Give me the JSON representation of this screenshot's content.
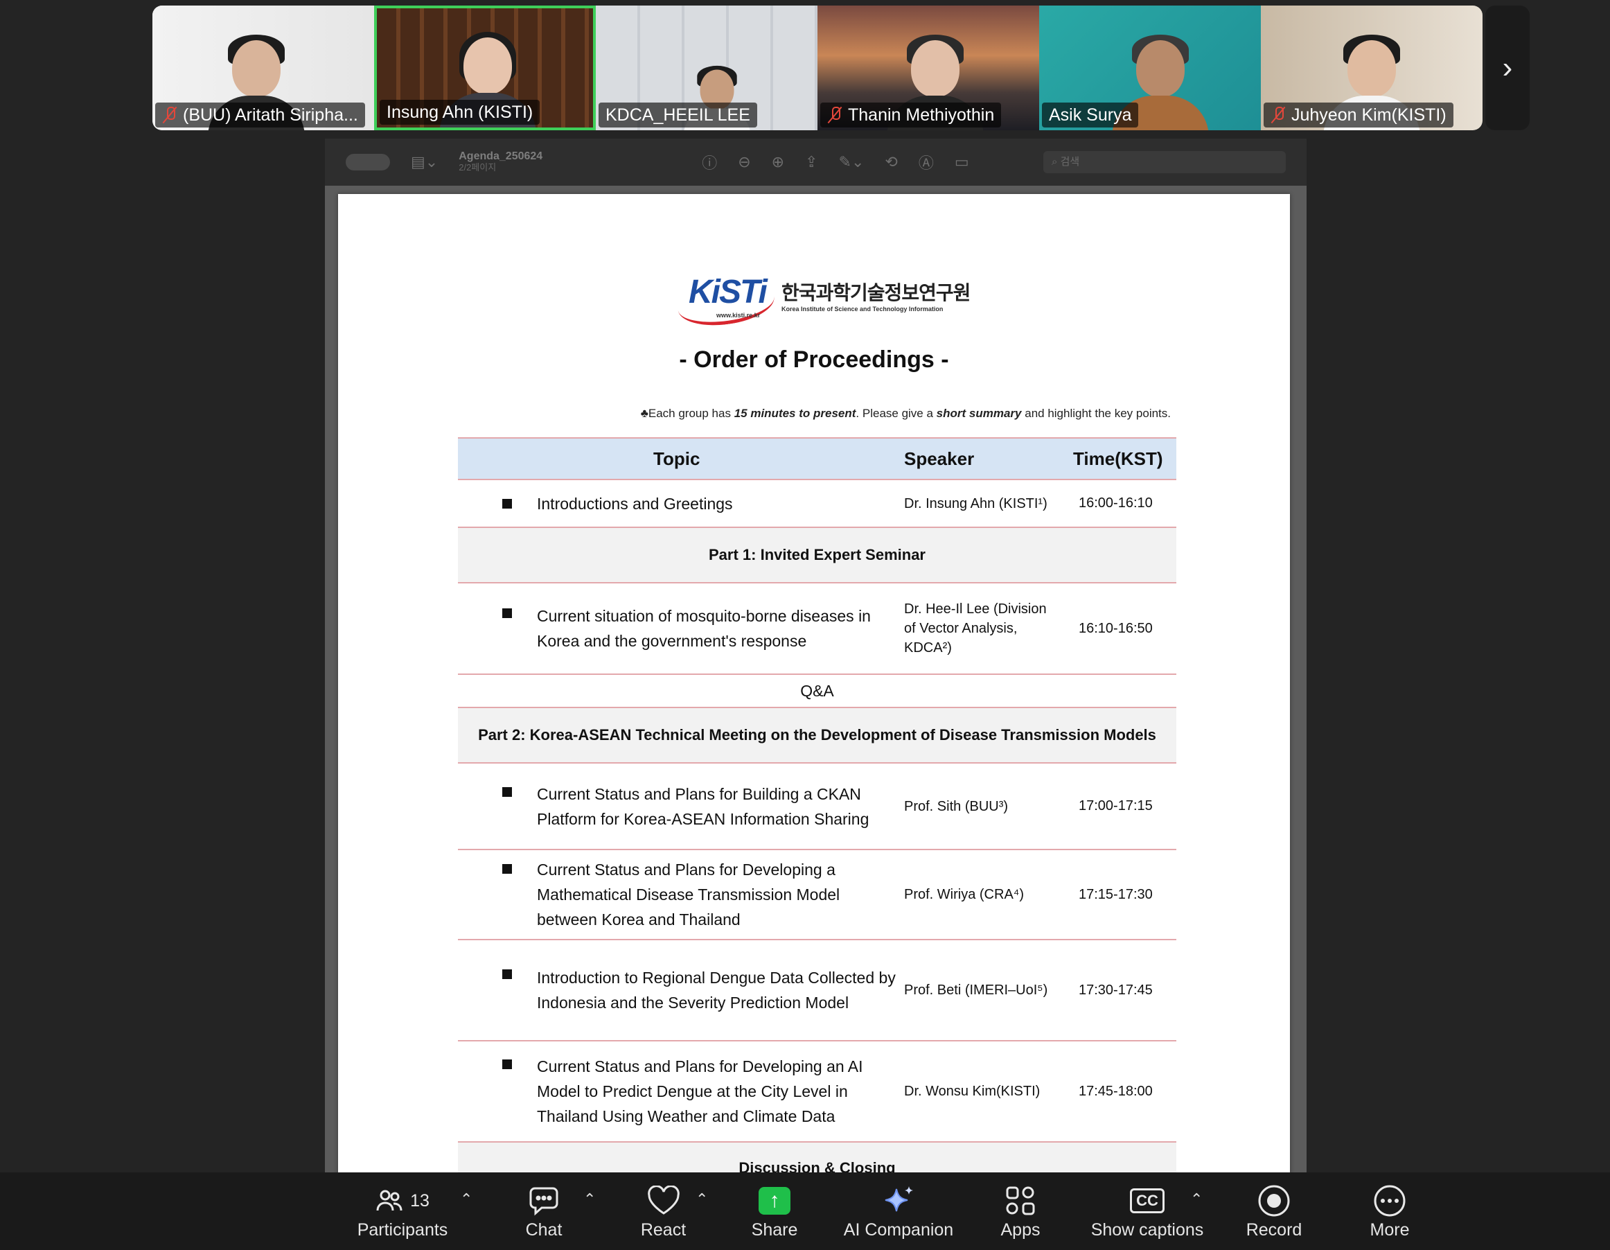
{
  "participants": [
    {
      "name": "(BUU) Aritath Siripha...",
      "muted": true,
      "active": false
    },
    {
      "name": "Insung Ahn (KISTI)",
      "muted": false,
      "active": true
    },
    {
      "name": "KDCA_HEEIL LEE",
      "muted": false,
      "active": false
    },
    {
      "name": "Thanin Methiyothin",
      "muted": true,
      "active": false
    },
    {
      "name": "Asik Surya",
      "muted": false,
      "active": false
    },
    {
      "name": "Juhyeon Kim(KISTI)",
      "muted": true,
      "active": false
    }
  ],
  "viewer": {
    "file_name": "Agenda_250624",
    "page_info": "2/2페이지",
    "search_placeholder": "검색"
  },
  "document": {
    "logo_korean": "한국과학기술정보연구원",
    "logo_english": "Korea Institute of Science and Technology Information",
    "logo_url": "www.kisti.re.kr",
    "logo_mark": "KiSTi",
    "title": "- Order of Proceedings -",
    "note_prefix": "♣Each group has",
    "note_em1": "15 minutes to present",
    "note_mid": ". Please give a",
    "note_em2": "short summary",
    "note_suffix": "and highlight the key points.",
    "headers": {
      "topic": "Topic",
      "speaker": "Speaker",
      "time": "Time(KST)"
    },
    "items": {
      "intro": {
        "topic": "Introductions and Greetings",
        "speaker": "Dr. Insung Ahn (KISTI¹)",
        "time": "16:00-16:10"
      },
      "part1": "Part 1: Invited Expert Seminar",
      "seminar": {
        "topic": "Current situation of mosquito-borne diseases in Korea and the government's response",
        "speaker": "Dr. Hee-Il Lee (Division of Vector Analysis, KDCA²)",
        "time": "16:10-16:50"
      },
      "qa": "Q&A",
      "part2": "Part 2: Korea-ASEAN Technical Meeting on the Development of Disease Transmission Models",
      "t1": {
        "topic": "Current Status and Plans for Building a CKAN Platform for Korea-ASEAN Information Sharing",
        "speaker": "Prof. Sith (BUU³)",
        "time": "17:00-17:15"
      },
      "t2": {
        "topic": "Current Status and Plans for Developing a Mathematical Disease Transmission Model between Korea and Thailand",
        "speaker": "Prof. Wiriya (CRA⁴)",
        "time": "17:15-17:30"
      },
      "t3": {
        "topic": "Introduction to Regional Dengue Data Collected by Indonesia and the Severity Prediction Model",
        "speaker": "Prof. Beti (IMERI–UoI⁵)",
        "time": "17:30-17:45"
      },
      "t4": {
        "topic": "Current Status and Plans for Developing an AI Model to Predict Dengue at the City Level in Thailand Using Weather and Climate Data",
        "speaker": "Dr. Wonsu Kim(KISTI)",
        "time": "17:45-18:00"
      },
      "closing": "Discussion & Closing"
    }
  },
  "controls": {
    "participants_label": "Participants",
    "participants_count": "13",
    "chat_label": "Chat",
    "react_label": "React",
    "share_label": "Share",
    "ai_label": "AI Companion",
    "apps_label": "Apps",
    "captions_label": "Show captions",
    "captions_icon_text": "CC",
    "record_label": "Record",
    "more_label": "More"
  },
  "colors": {
    "active_speaker": "#3fcf5a",
    "share_green": "#1fbf4a",
    "muted_red": "#e4473b",
    "table_header": "#d6e4f4",
    "row_rule": "#e3a8ac"
  }
}
